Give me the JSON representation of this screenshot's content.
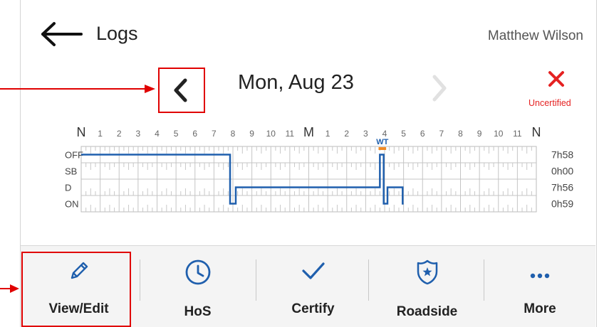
{
  "header": {
    "title": "Logs",
    "user_name": "Matthew Wilson"
  },
  "date_nav": {
    "date": "Mon, Aug 23",
    "status": "Uncertified"
  },
  "graph": {
    "hour_labels": [
      "N",
      "1",
      "2",
      "3",
      "4",
      "5",
      "6",
      "7",
      "8",
      "9",
      "10",
      "11",
      "M",
      "1",
      "2",
      "3",
      "4",
      "5",
      "6",
      "7",
      "8",
      "9",
      "10",
      "11",
      "N"
    ],
    "rows": [
      {
        "label": "OFF",
        "total": "7h58"
      },
      {
        "label": "SB",
        "total": "0h00"
      },
      {
        "label": "D",
        "total": "7h56"
      },
      {
        "label": "ON",
        "total": "0h59"
      }
    ],
    "event_label": "WT",
    "status_line_color": "#1f5fad",
    "event_color": "#f08a24"
  },
  "toolbar": {
    "items": [
      {
        "label": "View/Edit",
        "icon": "pencil-icon"
      },
      {
        "label": "HoS",
        "icon": "clock-icon"
      },
      {
        "label": "Certify",
        "icon": "checkmark-icon"
      },
      {
        "label": "Roadside",
        "icon": "badge-icon"
      },
      {
        "label": "More",
        "icon": "more-dots-icon"
      }
    ]
  },
  "colors": {
    "accent_blue": "#1f5fad",
    "annotation_red": "#e00000",
    "uncertified_red": "#e52222"
  }
}
